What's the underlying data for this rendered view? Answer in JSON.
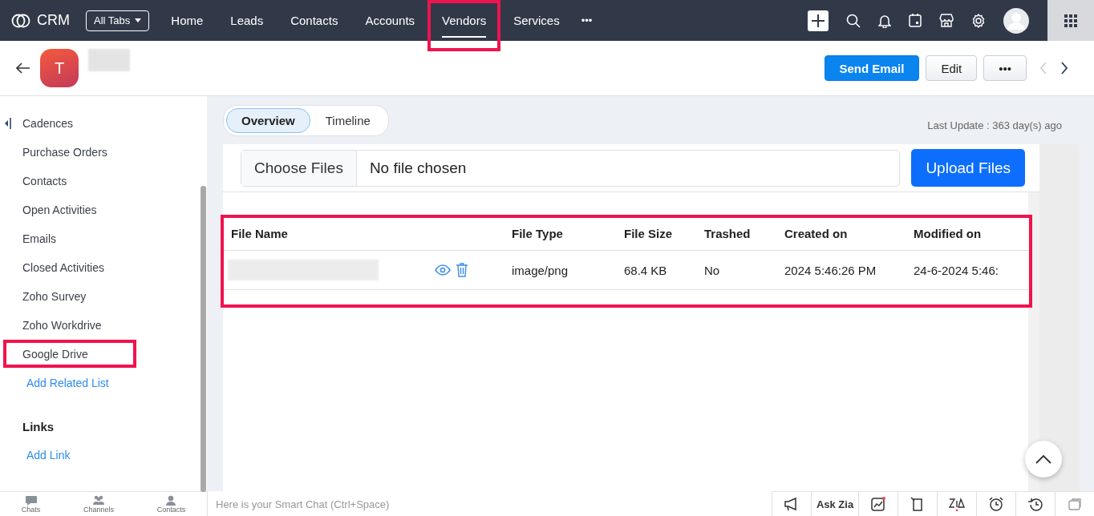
{
  "topbar": {
    "brand": "CRM",
    "all_tabs": "All Tabs",
    "nav": [
      {
        "label": "Home",
        "selected": false,
        "highlighted": false
      },
      {
        "label": "Leads",
        "selected": false,
        "highlighted": false
      },
      {
        "label": "Contacts",
        "selected": false,
        "highlighted": false
      },
      {
        "label": "Accounts",
        "selected": false,
        "highlighted": false
      },
      {
        "label": "Vendors",
        "selected": true,
        "highlighted": true
      },
      {
        "label": "Services",
        "selected": false,
        "highlighted": false
      }
    ],
    "more": "•••"
  },
  "record": {
    "avatar_letter": "T",
    "actions": [
      {
        "label": "Send Email",
        "kind": "primary"
      },
      {
        "label": "Edit",
        "kind": "secondary"
      },
      {
        "label": "•••",
        "kind": "secondary"
      }
    ]
  },
  "sidebar": {
    "items": [
      {
        "label": "Cadences",
        "highlighted": false
      },
      {
        "label": "Purchase Orders",
        "highlighted": false
      },
      {
        "label": "Contacts",
        "highlighted": false
      },
      {
        "label": "Open Activities",
        "highlighted": false
      },
      {
        "label": "Emails",
        "highlighted": false
      },
      {
        "label": "Closed Activities",
        "highlighted": false
      },
      {
        "label": "Zoho Survey",
        "highlighted": false
      },
      {
        "label": "Zoho Workdrive",
        "highlighted": false
      },
      {
        "label": "Google Drive",
        "highlighted": true
      }
    ],
    "add_related": "Add Related List",
    "links_heading": "Links",
    "add_link": "Add Link"
  },
  "view_tabs": [
    {
      "label": "Overview",
      "selected": true
    },
    {
      "label": "Timeline",
      "selected": false
    }
  ],
  "last_update": "Last Update : 363 day(s) ago",
  "upload": {
    "choose": "Choose Files",
    "status": "No file chosen",
    "button": "Upload Files"
  },
  "table": {
    "highlighted": true,
    "columns": [
      "File Name",
      "File Type",
      "File Size",
      "Trashed",
      "Created on",
      "Modified on"
    ],
    "rows": [
      {
        "file_type": "image/png",
        "file_size": "68.4 KB",
        "trashed": "No",
        "created_on": "2024 5:46:26 PM",
        "modified_on": "24-6-2024 5:46:"
      }
    ]
  },
  "bottom": {
    "chat_tabs": [
      "Chats",
      "Channels",
      "Contacts"
    ],
    "smart_chat_placeholder": "Here is your Smart Chat (Ctrl+Space)",
    "ask_zia": "Ask Zia"
  }
}
